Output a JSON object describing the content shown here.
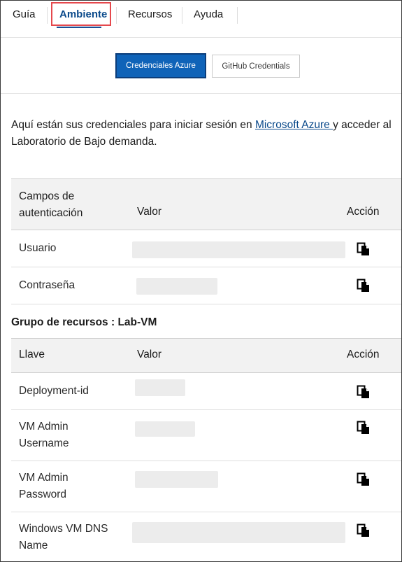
{
  "tabs": [
    {
      "label": "Guía"
    },
    {
      "label": "Ambiente"
    },
    {
      "label": "Recursos"
    },
    {
      "label": "Ayuda"
    }
  ],
  "credential_buttons": {
    "azure": "Credenciales Azure",
    "github": "GitHub Credentials"
  },
  "intro": {
    "before": "Aquí están sus credenciales para iniciar sesión en ",
    "link": "Microsoft Azure ",
    "after": "y acceder al Laboratorio de Bajo demanda."
  },
  "auth_table": {
    "headers": {
      "field": "Campos de autenticación",
      "value": "Valor",
      "action": "Acción"
    },
    "rows": [
      {
        "label": "Usuario"
      },
      {
        "label": "Contraseña"
      }
    ]
  },
  "resource_group": {
    "title": "Grupo de recursos : Lab-VM"
  },
  "resource_table": {
    "headers": {
      "key": "Llave",
      "value": "Valor",
      "action": "Acción"
    },
    "rows": [
      {
        "label": "Deployment-id"
      },
      {
        "label": "VM Admin Username"
      },
      {
        "label": "VM Admin Password"
      },
      {
        "label": "Windows VM DNS Name"
      }
    ]
  },
  "icons": {
    "copy": "copy-icon"
  },
  "colors": {
    "accent": "#0f63b8",
    "active_tab": "#0b4a8b",
    "highlight": "#e5484d"
  }
}
